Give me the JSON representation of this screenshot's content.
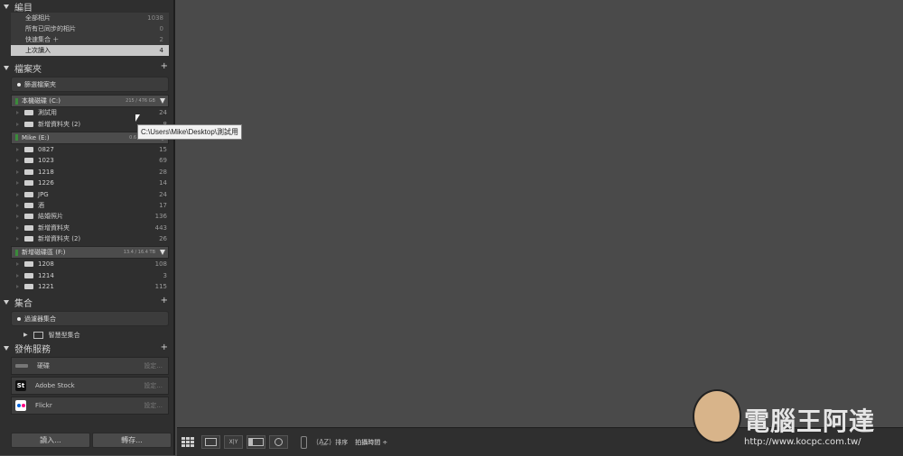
{
  "catalog": {
    "title": "編目",
    "items": [
      {
        "label": "全部相片",
        "count": "1038"
      },
      {
        "label": "所有已同步的相片",
        "count": "0"
      },
      {
        "label": "快速集合 ＋",
        "count": "2"
      },
      {
        "label": "上次讀入",
        "count": "4"
      }
    ]
  },
  "folders": {
    "title": "檔案夾",
    "search_label": "篩選檔案夾",
    "volumes": [
      {
        "name": "本機磁碟 (C:)",
        "size": "215 / 476 GB",
        "folders": [
          {
            "name": "測試用",
            "count": "24"
          },
          {
            "name": "新增資料夾 (2)",
            "count": "8"
          }
        ]
      },
      {
        "name": "Mike (E:)",
        "size": "0.6 / 1.8 TB",
        "folders": [
          {
            "name": "0827",
            "count": "15"
          },
          {
            "name": "1023",
            "count": "69"
          },
          {
            "name": "1218",
            "count": "28"
          },
          {
            "name": "1226",
            "count": "14"
          },
          {
            "name": "JPG",
            "count": "24"
          },
          {
            "name": "酒",
            "count": "17"
          },
          {
            "name": "結婚照片",
            "count": "136"
          },
          {
            "name": "新增資料夾",
            "count": "443"
          },
          {
            "name": "新增資料夾 (2)",
            "count": "26"
          }
        ]
      },
      {
        "name": "新增磁碟區 (F:)",
        "size": "13.4 / 16.4 TB",
        "folders": [
          {
            "name": "1208",
            "count": "108"
          },
          {
            "name": "1214",
            "count": "3"
          },
          {
            "name": "1221",
            "count": "115"
          }
        ]
      }
    ]
  },
  "tooltip": "C:\\Users\\Mike\\Desktop\\測試用",
  "collections": {
    "title": "集合",
    "filter_label": "過濾器集合",
    "smart_label": "智慧型集合"
  },
  "publish": {
    "title": "發佈服務",
    "services": [
      {
        "name": "硬碟",
        "setup": "設定..."
      },
      {
        "name": "Adobe Stock",
        "setup": "設定...",
        "icon": "St"
      },
      {
        "name": "Flickr",
        "setup": "設定..."
      }
    ]
  },
  "buttons": {
    "import": "讀入...",
    "export": "轉存..."
  },
  "toolbar": {
    "sort_label": "排序",
    "sort_value": "拍攝時間 ÷"
  },
  "watermark": {
    "title": "電腦王阿達",
    "url": "http://www.kocpc.com.tw/"
  }
}
